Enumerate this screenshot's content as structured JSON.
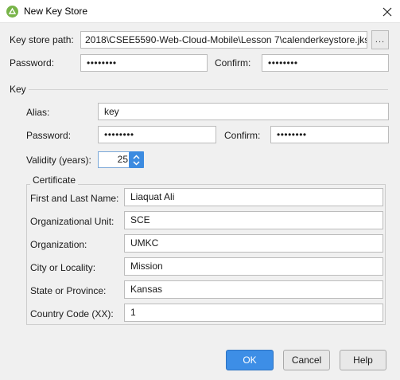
{
  "window": {
    "title": "New Key Store"
  },
  "icons": {
    "app": "android-studio-icon",
    "close": "close-icon",
    "spin_up": "chevron-up-icon",
    "spin_down": "chevron-down-icon"
  },
  "keystore": {
    "path_label": "Key store path:",
    "path_value": "2018\\CSEE5590-Web-Cloud-Mobile\\Lesson 7\\calenderkeystore.jks",
    "browse_label": "...",
    "password_label": "Password:",
    "password_value": "••••••••",
    "confirm_label": "Confirm:",
    "confirm_value": "••••••••"
  },
  "key": {
    "section_label": "Key",
    "alias_label": "Alias:",
    "alias_value": "key",
    "password_label": "Password:",
    "password_value": "••••••••",
    "confirm_label": "Confirm:",
    "confirm_value": "••••••••",
    "validity_label": "Validity (years):",
    "validity_value": "25"
  },
  "certificate": {
    "title": "Certificate",
    "fields": [
      {
        "label": "First and Last Name:",
        "value": "Liaquat Ali"
      },
      {
        "label": "Organizational Unit:",
        "value": "SCE"
      },
      {
        "label": "Organization:",
        "value": "UMKC"
      },
      {
        "label": "City or Locality:",
        "value": "Mission"
      },
      {
        "label": "State or Province:",
        "value": "Kansas"
      },
      {
        "label": "Country Code (XX):",
        "value": "1"
      }
    ]
  },
  "buttons": {
    "ok": "OK",
    "cancel": "Cancel",
    "help": "Help"
  },
  "colors": {
    "accent": "#3d8ee6",
    "background": "#f0f0f0"
  }
}
